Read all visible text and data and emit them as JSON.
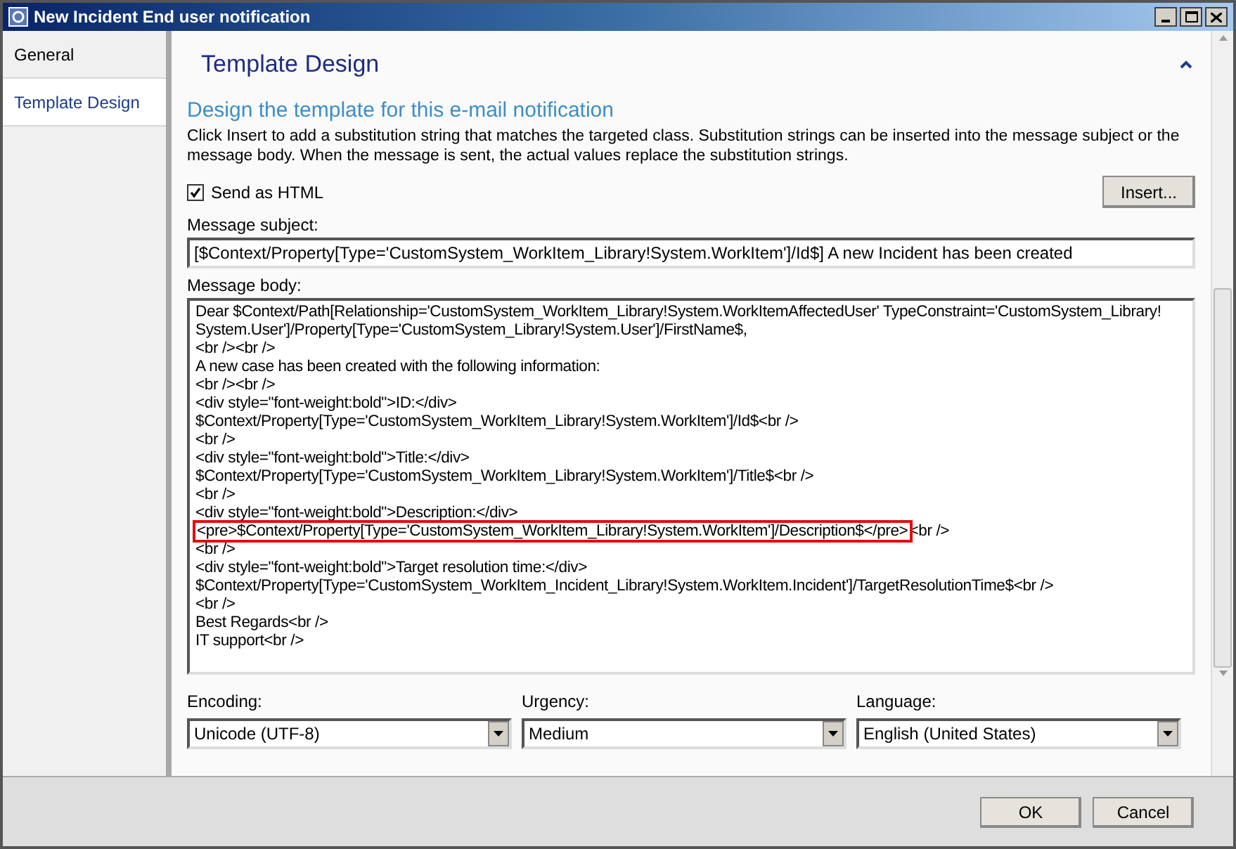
{
  "window": {
    "title": "New Incident End user notification"
  },
  "sidebar": {
    "items": [
      {
        "label": "General",
        "selected": false
      },
      {
        "label": "Template Design",
        "selected": true
      }
    ]
  },
  "page": {
    "title": "Template Design",
    "expanded": true,
    "heading": "Design the template for this e-mail notification",
    "description": "Click Insert to add a substitution string that matches the targeted class. Substitution strings can be inserted into the message subject or the message body. When the message is sent, the actual values replace the substitution strings."
  },
  "send_as_html": {
    "label": "Send as HTML",
    "checked": true
  },
  "insert_button": "Insert...",
  "subject": {
    "label": "Message subject:",
    "value": "[$Context/Property[Type='CustomSystem_WorkItem_Library!System.WorkItem']/Id$] A new Incident has been created"
  },
  "body": {
    "label": "Message body:",
    "lines": [
      {
        "text": "Dear $Context/Path[Relationship='CustomSystem_WorkItem_Library!System.WorkItemAffectedUser' TypeConstraint='CustomSystem_Library!",
        "highlighted": false
      },
      {
        "text": "System.User']/Property[Type='CustomSystem_Library!System.User']/FirstName$,",
        "highlighted": false
      },
      {
        "text": "<br /><br />",
        "highlighted": false
      },
      {
        "text": "A new case has been created with the following information:",
        "highlighted": false
      },
      {
        "text": "<br /><br />",
        "highlighted": false
      },
      {
        "text": "<div style=\"font-weight:bold\">ID:</div>",
        "highlighted": false
      },
      {
        "text": "$Context/Property[Type='CustomSystem_WorkItem_Library!System.WorkItem']/Id$<br />",
        "highlighted": false
      },
      {
        "text": "<br />",
        "highlighted": false
      },
      {
        "text": "<div style=\"font-weight:bold\">Title:</div>",
        "highlighted": false
      },
      {
        "text": "$Context/Property[Type='CustomSystem_WorkItem_Library!System.WorkItem']/Title$<br />",
        "highlighted": false
      },
      {
        "text": "<br />",
        "highlighted": false
      },
      {
        "text": "<div style=\"font-weight:bold\">Description:</div>",
        "highlighted": false
      },
      {
        "text": "<pre>$Context/Property[Type='CustomSystem_WorkItem_Library!System.WorkItem']/Description$</pre>",
        "after": "<br />",
        "highlighted": true
      },
      {
        "text": "<br />",
        "highlighted": false
      },
      {
        "text": "<div style=\"font-weight:bold\">Target resolution time:</div>",
        "highlighted": false
      },
      {
        "text": "$Context/Property[Type='CustomSystem_WorkItem_Incident_Library!System.WorkItem.Incident']/TargetResolutionTime$<br />",
        "highlighted": false
      },
      {
        "text": "<br />",
        "highlighted": false
      },
      {
        "text": "Best Regards<br />",
        "highlighted": false
      },
      {
        "text": "IT support<br />",
        "highlighted": false
      }
    ]
  },
  "dropdowns": [
    {
      "label": "Encoding:",
      "value": "Unicode (UTF-8)"
    },
    {
      "label": "Urgency:",
      "value": "Medium"
    },
    {
      "label": "Language:",
      "value": "English (United States)"
    }
  ],
  "buttons": [
    "OK",
    "Cancel"
  ]
}
